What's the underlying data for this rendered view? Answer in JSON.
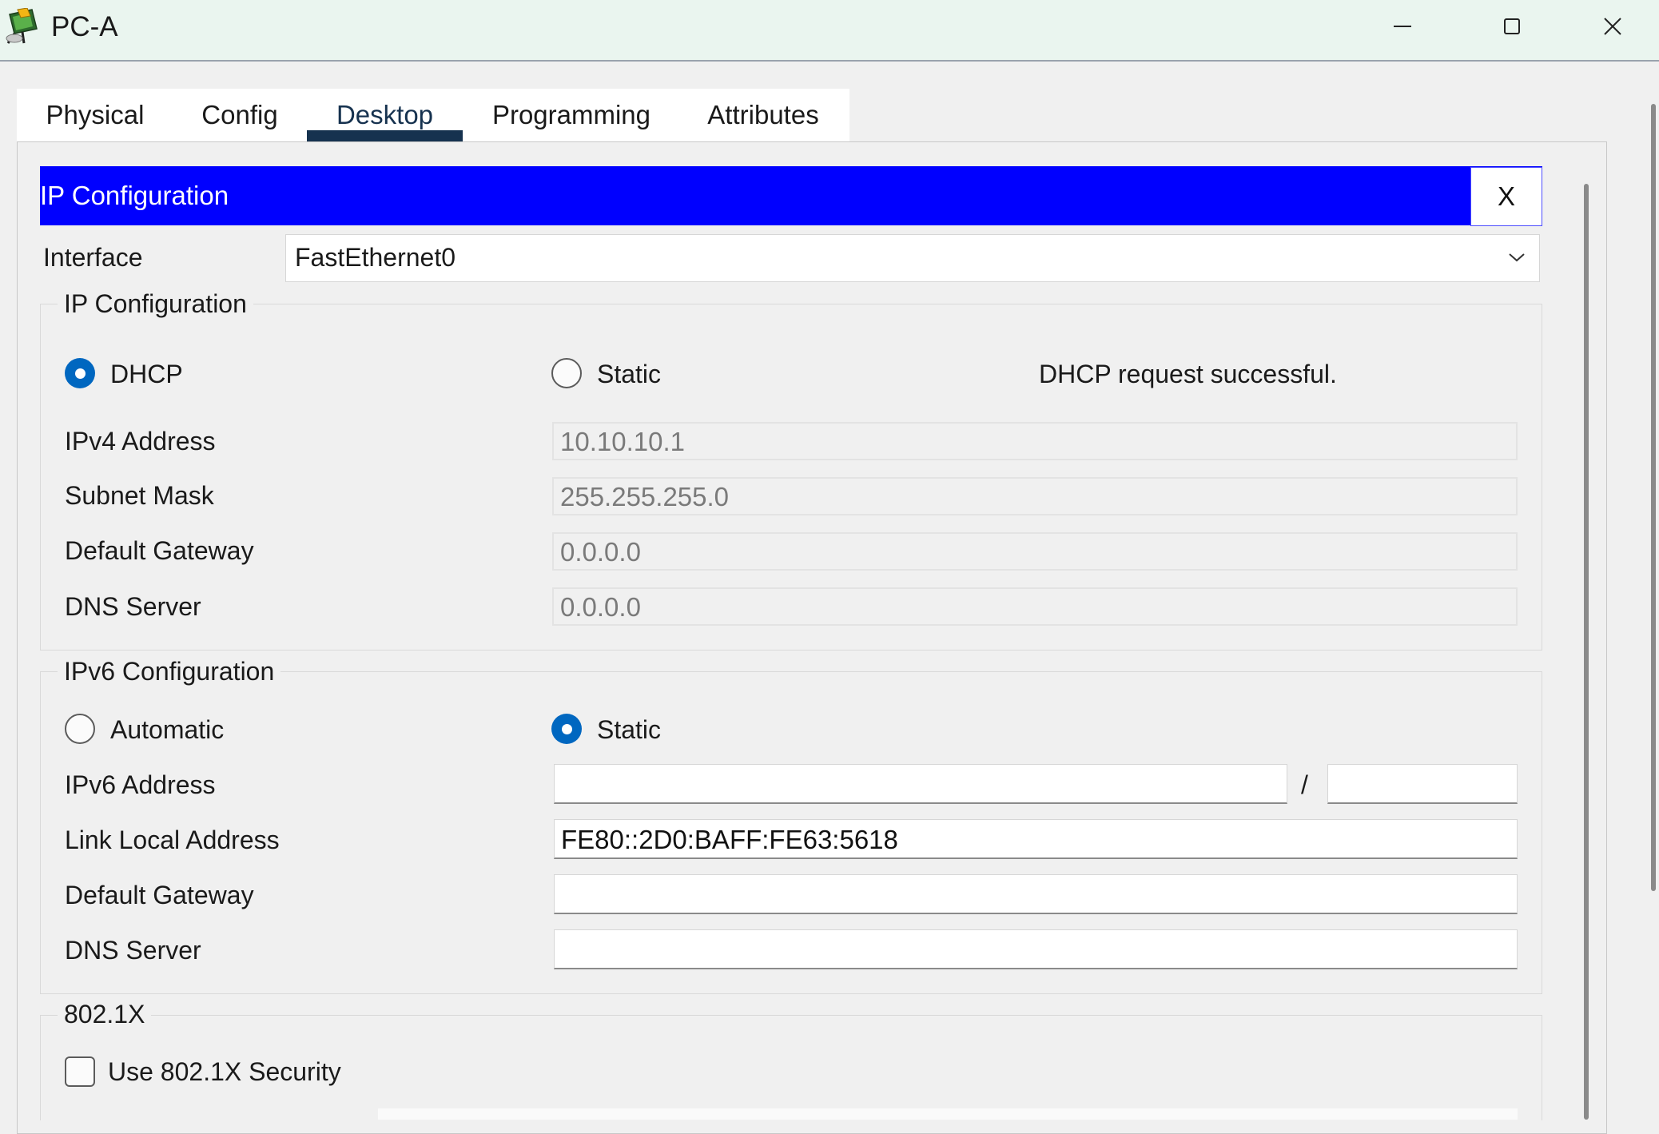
{
  "window": {
    "title": "PC-A",
    "icon": "packet-tracer-pc-icon",
    "controls": [
      "minimize-icon",
      "maximize-icon",
      "close-icon"
    ]
  },
  "tabs": [
    {
      "label": "Physical",
      "active": false
    },
    {
      "label": "Config",
      "active": false
    },
    {
      "label": "Desktop",
      "active": true
    },
    {
      "label": "Programming",
      "active": false
    },
    {
      "label": "Attributes",
      "active": false
    }
  ],
  "ip_config": {
    "header_title": "IP Configuration",
    "close_label": "X",
    "interface_label": "Interface",
    "interface_value": "FastEthernet0",
    "ipv4": {
      "group_title": "IP Configuration",
      "dhcp_label": "DHCP",
      "static_label": "Static",
      "mode": "DHCP",
      "status": "DHCP request successful.",
      "fields": [
        {
          "label": "IPv4 Address",
          "value": "10.10.10.1"
        },
        {
          "label": "Subnet Mask",
          "value": "255.255.255.0"
        },
        {
          "label": "Default Gateway",
          "value": "0.0.0.0"
        },
        {
          "label": "DNS Server",
          "value": "0.0.0.0"
        }
      ]
    },
    "ipv6": {
      "group_title": "IPv6 Configuration",
      "automatic_label": "Automatic",
      "static_label": "Static",
      "mode": "Static",
      "address_label": "IPv6 Address",
      "address_value": "",
      "prefix_separator": "/",
      "prefix_value": "",
      "link_local_label": "Link Local Address",
      "link_local_value": "FE80::2D0:BAFF:FE63:5618",
      "gateway_label": "Default Gateway",
      "gateway_value": "",
      "dns_label": "DNS Server",
      "dns_value": ""
    },
    "dot1x": {
      "group_title": "802.1X",
      "checkbox_label": "Use 802.1X Security",
      "checked": false
    }
  },
  "colors": {
    "title_bar": "#eaf5ef",
    "header_bar": "#0000ff",
    "active_tab": "#16324f",
    "radio_on": "#0067c0"
  }
}
